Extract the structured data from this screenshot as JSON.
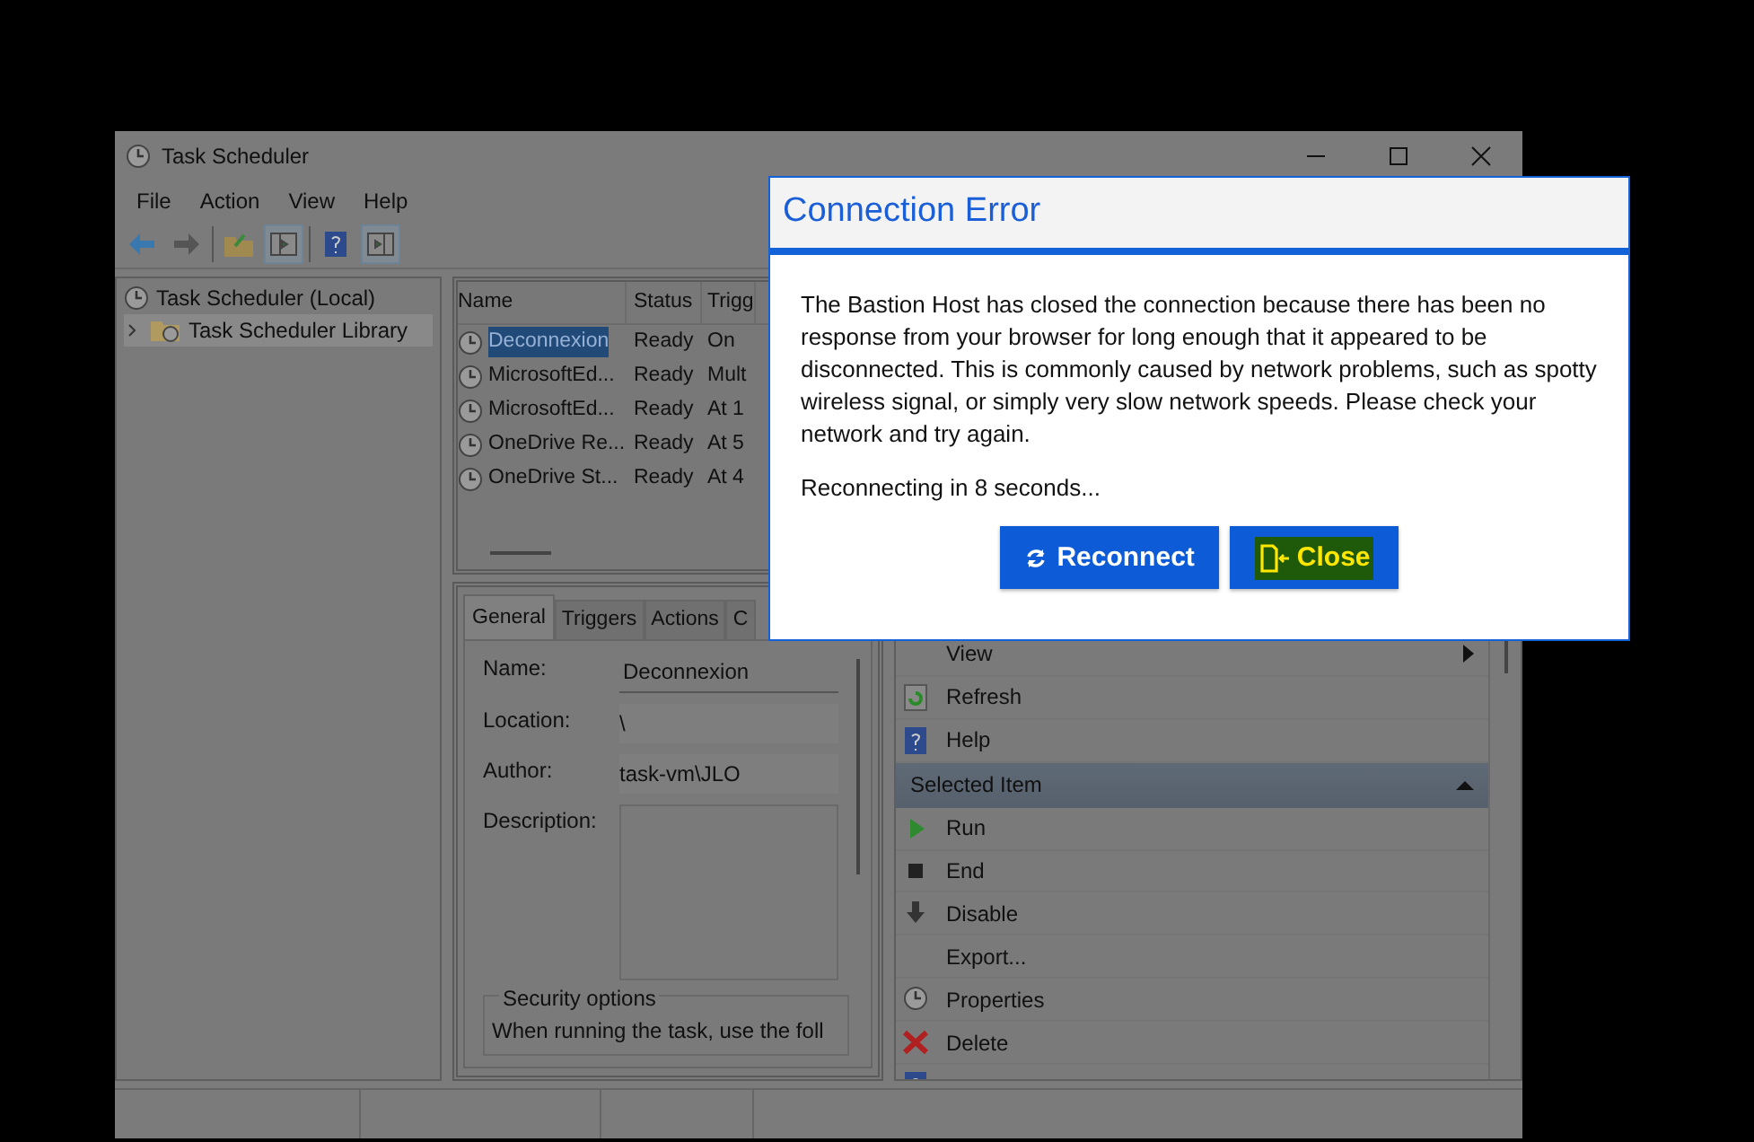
{
  "window": {
    "title": "Task Scheduler"
  },
  "menu": [
    "File",
    "Action",
    "View",
    "Help"
  ],
  "tree": [
    {
      "label": "Task Scheduler (Local)",
      "selected": false,
      "children": [
        {
          "label": "Task Scheduler Library",
          "selected": true,
          "expanded": false
        }
      ]
    }
  ],
  "task_list": {
    "columns": [
      "Name",
      "Status",
      "Trigg"
    ],
    "rows": [
      {
        "cells": [
          "Deconnexion",
          "Ready",
          "On"
        ],
        "selected": true
      },
      {
        "cells": [
          "MicrosoftEd...",
          "Ready",
          "Mult"
        ],
        "selected": false
      },
      {
        "cells": [
          "MicrosoftEd...",
          "Ready",
          "At 1"
        ],
        "selected": false
      },
      {
        "cells": [
          "OneDrive Re...",
          "Ready",
          "At 5"
        ],
        "selected": false
      },
      {
        "cells": [
          "OneDrive St...",
          "Ready",
          "At 4"
        ],
        "selected": false
      }
    ]
  },
  "detail": {
    "tabs": [
      {
        "label": "General",
        "selected": true
      },
      {
        "label": "Triggers",
        "selected": false
      },
      {
        "label": "Actions",
        "selected": false
      },
      {
        "label": "C",
        "selected": false
      }
    ],
    "fields": [
      {
        "label": "Name:",
        "value": "Deconnexion",
        "kind": "input"
      },
      {
        "label": "Location:",
        "value": "\\",
        "kind": "text"
      },
      {
        "label": "Author:",
        "value": "task-vm\\JLO",
        "kind": "text"
      },
      {
        "label": "Description:",
        "kind": "textarea"
      }
    ],
    "security": {
      "title": "Security options",
      "text": "When running the task, use the foll"
    }
  },
  "actions": [
    {
      "items": [
        {
          "label": "View",
          "kind": "submenu"
        },
        {
          "label": "Refresh",
          "kind": "item"
        },
        {
          "label": "Help",
          "kind": "item"
        }
      ]
    },
    {
      "header": "Selected Item",
      "expanded": true,
      "items": [
        {
          "label": "Run",
          "kind": "item"
        },
        {
          "label": "End",
          "kind": "item"
        },
        {
          "label": "Disable",
          "kind": "item"
        },
        {
          "label": "Export...",
          "kind": "item"
        },
        {
          "label": "Properties",
          "kind": "item"
        },
        {
          "label": "Delete",
          "kind": "item"
        }
      ]
    }
  ],
  "dialog": {
    "title": "Connection Error",
    "message": "The Bastion Host has closed the connection because there has been no response from your browser for long enough that it appeared to be disconnected. This is commonly caused by network problems, such as spotty wireless signal, or simply very slow network speeds. Please check your network and try again.",
    "countdown": "Reconnecting in 8 seconds...",
    "buttons": [
      {
        "label": "Reconnect",
        "kind": "reconnect",
        "highlighted": false
      },
      {
        "label": "Close",
        "kind": "close",
        "highlighted": true
      }
    ]
  }
}
